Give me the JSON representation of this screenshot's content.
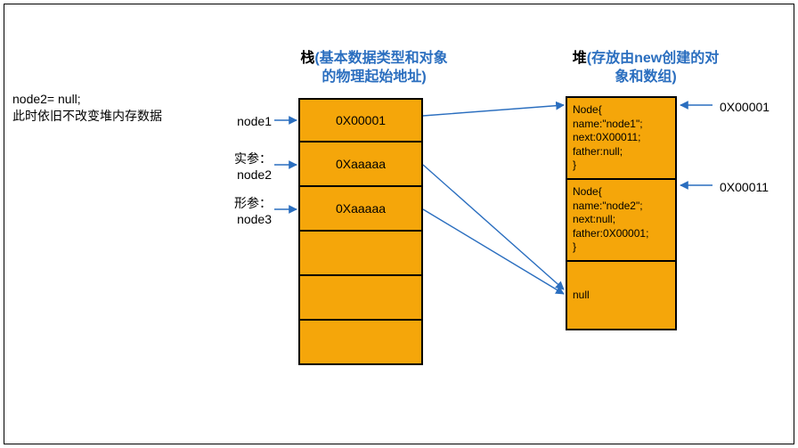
{
  "titles": {
    "stack_black": "栈",
    "stack_blue": "(基本数据类型和对象的物理起始地址)",
    "heap_black": "堆",
    "heap_blue": "(存放由new创建的对象和数组)"
  },
  "note": {
    "line1": "node2= null;",
    "line2": "此时依旧不改变堆内存数据"
  },
  "stack_labels": {
    "l1": "node1",
    "l2a": "实参：",
    "l2b": "node2",
    "l3a": "形参：",
    "l3b": "node3"
  },
  "stack_cells": {
    "c1": "0X00001",
    "c2": "0Xaaaaa",
    "c3": "0Xaaaaa",
    "c4": "",
    "c5": "",
    "c6": ""
  },
  "heap_cells": {
    "h1": "Node{\nname:\"node1\";\nnext:0X00011;\nfather:null;\n}",
    "h2": "Node{\nname:\"node2\";\nnext:null;\nfather:0X00001;\n}",
    "h3": "null"
  },
  "addrs": {
    "a1": "0X00001",
    "a2": "0X00011"
  }
}
